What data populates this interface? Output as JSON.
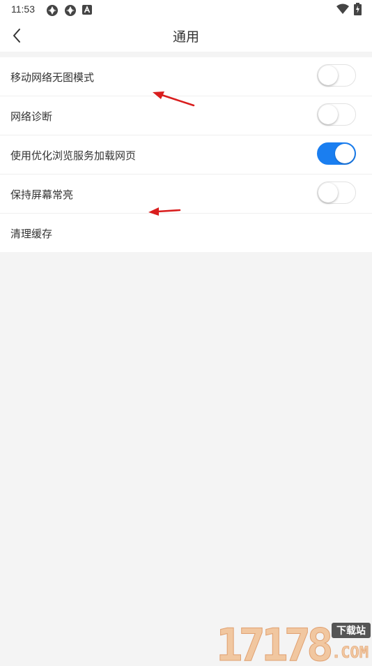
{
  "status_bar": {
    "time": "11:53",
    "left_icons": [
      "app-notification-icon",
      "app-notification-icon",
      "text-a-icon"
    ],
    "right_icons": [
      "wifi-icon",
      "battery-charging-icon"
    ]
  },
  "header": {
    "title": "通用",
    "back_icon": "chevron-left-icon"
  },
  "settings": [
    {
      "label": "移动网络无图模式",
      "toggle": false
    },
    {
      "label": "网络诊断",
      "toggle": false
    },
    {
      "label": "使用优化浏览服务加载网页",
      "toggle": true
    },
    {
      "label": "保持屏幕常亮",
      "toggle": false
    },
    {
      "label": "清理缓存"
    }
  ],
  "colors": {
    "accent": "#1a7ef0",
    "annotation_arrow": "#d91e1e",
    "background": "#f4f4f4"
  },
  "watermark": {
    "number": "17178",
    "badge": "下载站",
    "suffix": ".COM"
  }
}
